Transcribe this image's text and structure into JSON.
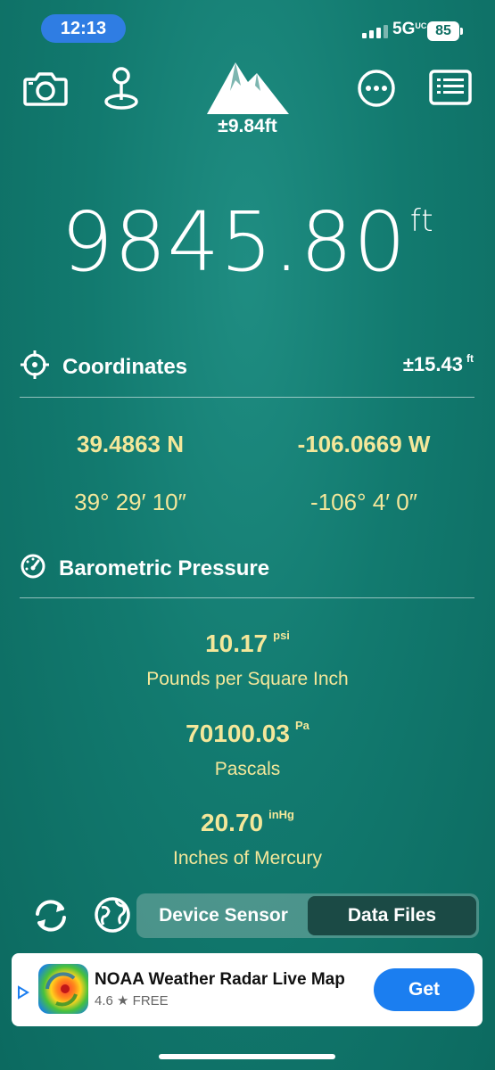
{
  "status_bar": {
    "time": "12:13",
    "network": "5G",
    "network_sup": "UC",
    "battery": "85"
  },
  "toolbar": {
    "icons": [
      "camera-icon",
      "location-pin-icon",
      "mountain-icon",
      "more-icon",
      "list-icon"
    ],
    "accuracy": "±9.84ft"
  },
  "altitude": {
    "value": "9845.80",
    "unit": "ft"
  },
  "coordinates": {
    "title": "Coordinates",
    "accuracy": "±15.43",
    "accuracy_unit": "ft",
    "lat_decimal": "39.4863 N",
    "lon_decimal": "-106.0669 W",
    "lat_dms": "39° 29′ 10″",
    "lon_dms": "-106° 4′ 0″"
  },
  "pressure": {
    "title": "Barometric Pressure",
    "readings": [
      {
        "value": "10.17",
        "unit": "psi",
        "label": "Pounds per Square Inch"
      },
      {
        "value": "70100.03",
        "unit": "Pa",
        "label": "Pascals"
      },
      {
        "value": "20.70",
        "unit": "inHg",
        "label": "Inches of Mercury"
      }
    ]
  },
  "source_toggle": {
    "options": [
      "Device Sensor",
      "Data Files"
    ],
    "selected": "Data Files"
  },
  "ad": {
    "title": "NOAA Weather Radar Live Map",
    "rating": "4.6",
    "price": "FREE",
    "button": "Get"
  },
  "colors": {
    "accent_yellow": "#f4e79a",
    "background": "#127a6f",
    "ad_button": "#1b7ef0"
  }
}
